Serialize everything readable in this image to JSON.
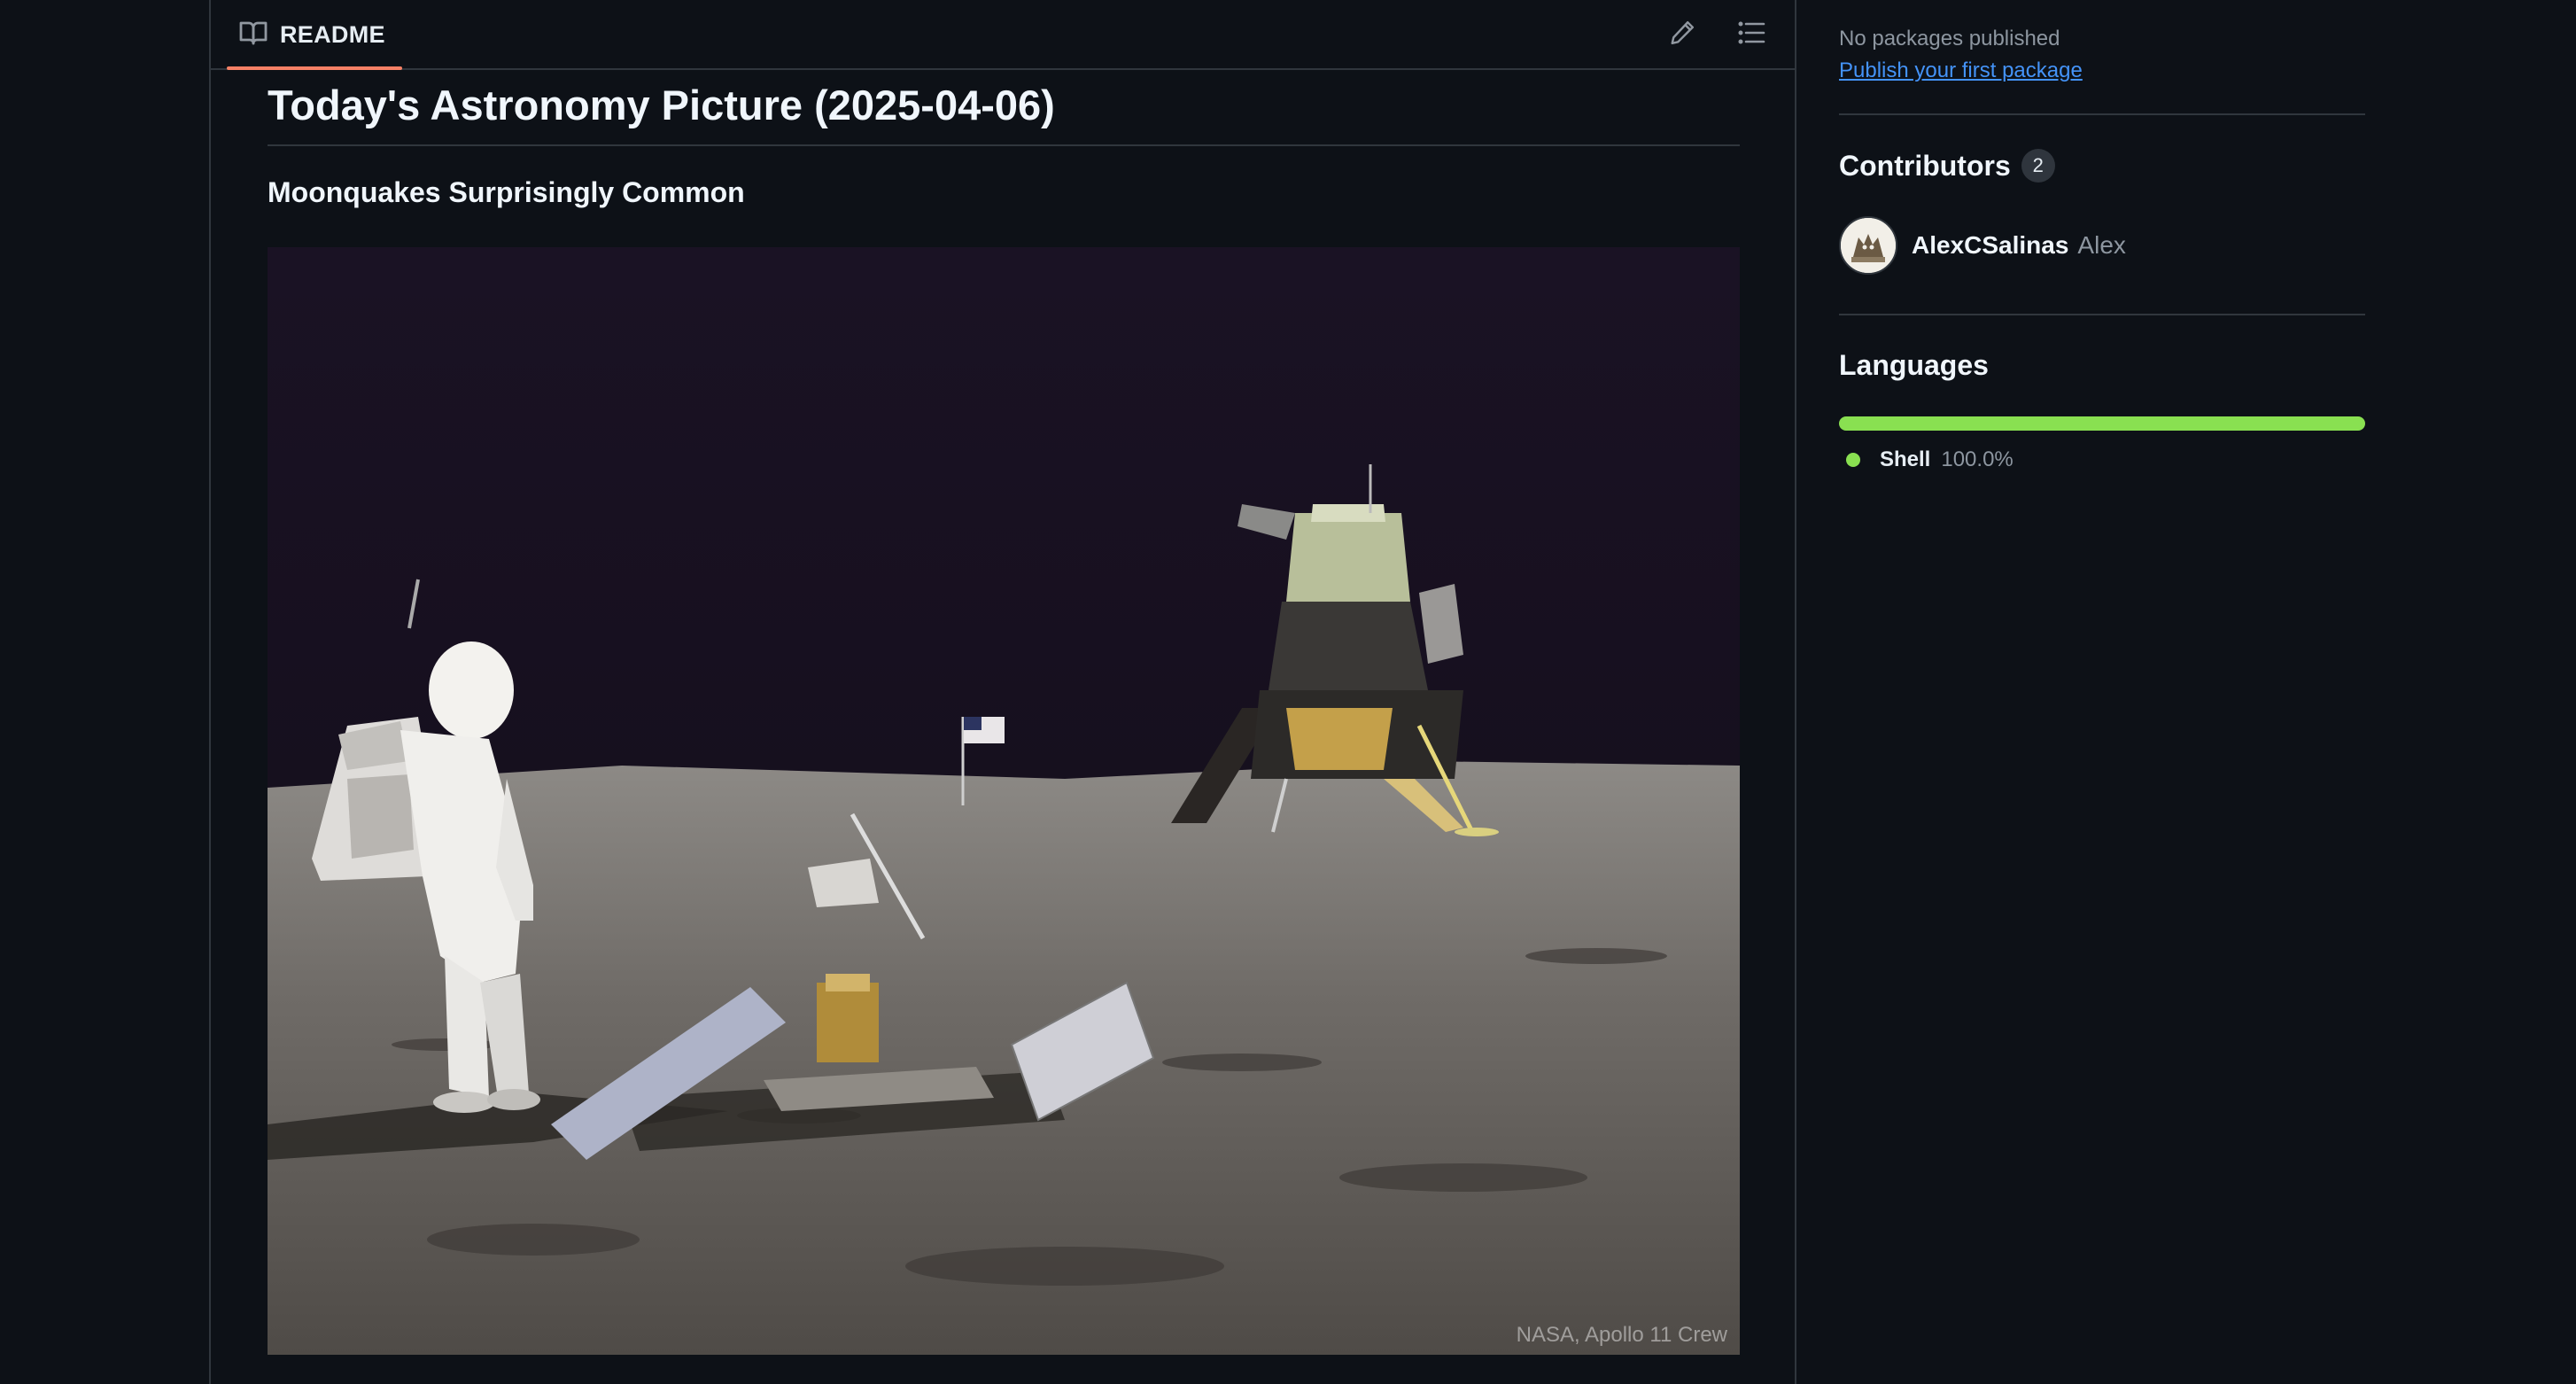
{
  "readme": {
    "tab_label": "README",
    "title": "Today's Astronomy Picture (2025-04-06)",
    "subtitle": "Moonquakes Surprisingly Common",
    "image_credit": "NASA, Apollo 11 Crew"
  },
  "sidebar": {
    "packages": {
      "empty_text": "No packages published",
      "link_text": "Publish your first package"
    },
    "contributors": {
      "title": "Contributors",
      "count": "2",
      "items": [
        {
          "login": "AlexCSalinas",
          "name": "Alex"
        }
      ]
    },
    "languages": {
      "title": "Languages",
      "items": [
        {
          "name": "Shell",
          "percent_text": "100.0%",
          "percent": 100.0,
          "color": "#89e051"
        }
      ]
    }
  },
  "colors": {
    "background": "#0d1117",
    "border": "#30363d",
    "link": "#4493f8",
    "tab_underline": "#f78166",
    "muted_text": "#8d96a0"
  },
  "icons": {
    "readme_tab": "book-icon",
    "edit": "pencil-icon",
    "toc": "list-unordered-icon"
  }
}
